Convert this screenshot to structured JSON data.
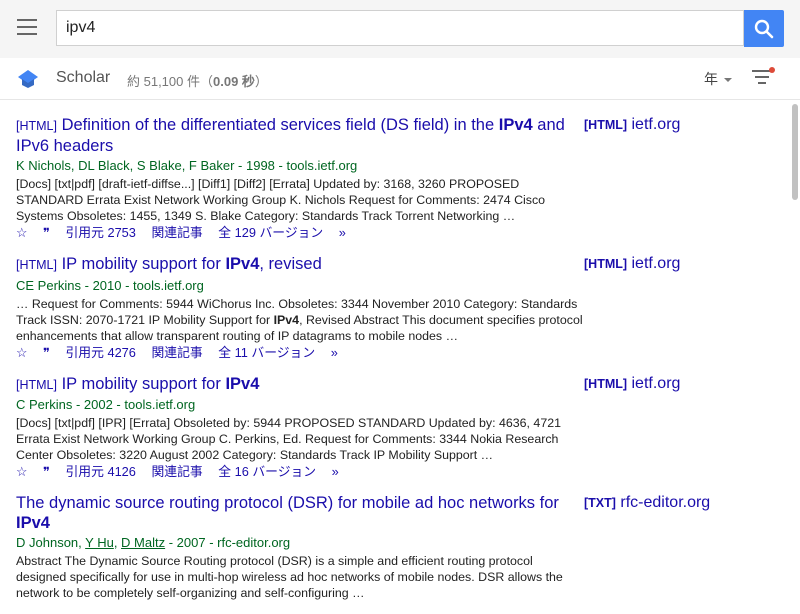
{
  "search": {
    "query": "ipv4"
  },
  "header": {
    "brand": "Scholar",
    "count_prefix": "約 51,100 件（",
    "time": "0.09 秒",
    "count_suffix": "）",
    "year_filter": "年"
  },
  "results": [
    {
      "tag": "[HTML]",
      "title_parts": [
        "Definition of the differentiated services field (DS field) in the ",
        "IPv4",
        " and IPv6 headers"
      ],
      "authors": "K Nichols, DL Black, S Blake, F Baker - 1998 - tools.ietf.org",
      "snippet": "[Docs] [txt|pdf] [draft-ietf-diffse...] [Diff1] [Diff2] [Errata] Updated by: 3168, 3260 PROPOSED STANDARD Errata Exist Network Working Group K. Nichols Request for Comments: 2474 Cisco Systems Obsoletes: 1455, 1349 S. Blake Category: Standards Track Torrent Networking …",
      "cited": "引用元 2753",
      "related": "関連記事",
      "versions": "全 129 バージョン",
      "side_type": "[HTML]",
      "side_domain": "ietf.org"
    },
    {
      "tag": "[HTML]",
      "title_parts": [
        "IP mobility support for ",
        "IPv4",
        ", revised"
      ],
      "authors": "CE Perkins - 2010 - tools.ietf.org",
      "snippet_parts": [
        "… Request for Comments: 5944 WiChorus Inc. Obsoletes: 3344 November 2010 Category: Standards Track ISSN: 2070-1721 IP Mobility Support for ",
        "IPv4",
        ", Revised Abstract This document specifies protocol enhancements that allow transparent routing of IP datagrams to mobile nodes …"
      ],
      "cited": "引用元 4276",
      "related": "関連記事",
      "versions": "全 11 バージョン",
      "side_type": "[HTML]",
      "side_domain": "ietf.org"
    },
    {
      "tag": "[HTML]",
      "title_parts": [
        "IP mobility support for ",
        "IPv4",
        ""
      ],
      "authors": "C Perkins - 2002 - tools.ietf.org",
      "snippet": "[Docs] [txt|pdf] [IPR] [Errata] Obsoleted by: 5944 PROPOSED STANDARD Updated by: 4636, 4721 Errata Exist Network Working Group C. Perkins, Ed. Request for Comments: 3344 Nokia Research Center Obsoletes: 3220 August 2002 Category: Standards Track IP Mobility Support …",
      "cited": "引用元 4126",
      "related": "関連記事",
      "versions": "全 16 バージョン",
      "side_type": "[HTML]",
      "side_domain": "ietf.org"
    },
    {
      "tag": "",
      "title_parts": [
        "The dynamic source routing protocol (DSR) for mobile ad hoc networks for ",
        "IPv4",
        ""
      ],
      "authors_parts": [
        "D Johnson, ",
        "Y Hu",
        ", ",
        "D Maltz",
        " - 2007 - rfc-editor.org"
      ],
      "snippet": "Abstract The Dynamic Source Routing protocol (DSR) is a simple and efficient routing protocol designed specifically for use in multi-hop wireless ad hoc networks of mobile nodes. DSR allows the network to be completely self-organizing and self-configuring …",
      "side_type": "[TXT]",
      "side_domain": "rfc-editor.org"
    }
  ]
}
